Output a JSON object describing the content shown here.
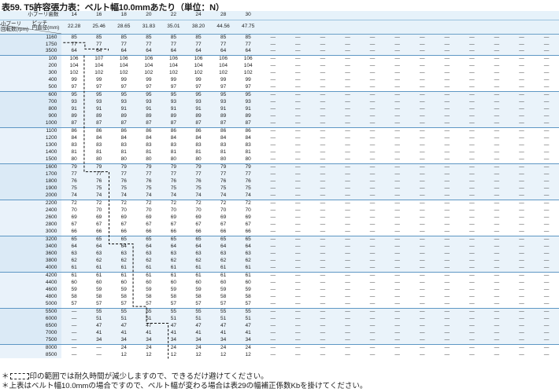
{
  "title": "表59. T5許容張力表：ベルト幅10.0mmあたり（単位：N）",
  "header": {
    "teeth_label": "小プーリ歯数",
    "pitch_label_line1": "ピッチ",
    "pitch_label_line2": "円直径(mm)",
    "rpm_label_line1": "小プーリ",
    "rpm_label_line2": "回転数(rpm)",
    "teeth": [
      "14",
      "16",
      "18",
      "20",
      "22",
      "24",
      "28",
      "30"
    ],
    "pitch_diameters": [
      "22.28",
      "25.46",
      "28.65",
      "31.83",
      "35.01",
      "38.20",
      "44.56",
      "47.75"
    ]
  },
  "dash_symbol": "—",
  "dash_columns": 12,
  "groups": [
    {
      "rows": [
        {
          "rpm": "1160",
          "values": [
            "85",
            "85",
            "85",
            "85",
            "85",
            "85",
            "85",
            "85"
          ]
        },
        {
          "rpm": "1750",
          "values": [
            "77",
            "77",
            "77",
            "77",
            "77",
            "77",
            "77",
            "77"
          ]
        },
        {
          "rpm": "3500",
          "values": [
            "64",
            "64",
            "64",
            "64",
            "64",
            "64",
            "64",
            "64"
          ]
        }
      ]
    },
    {
      "rows": [
        {
          "rpm": "100",
          "values": [
            "106",
            "107",
            "106",
            "106",
            "106",
            "106",
            "106",
            "106"
          ]
        },
        {
          "rpm": "200",
          "values": [
            "104",
            "104",
            "104",
            "104",
            "104",
            "104",
            "104",
            "104"
          ]
        },
        {
          "rpm": "300",
          "values": [
            "102",
            "102",
            "102",
            "102",
            "102",
            "102",
            "102",
            "102"
          ]
        },
        {
          "rpm": "400",
          "values": [
            "99",
            "99",
            "99",
            "99",
            "99",
            "99",
            "99",
            "99"
          ]
        },
        {
          "rpm": "500",
          "values": [
            "97",
            "97",
            "97",
            "97",
            "97",
            "97",
            "97",
            "97"
          ]
        }
      ]
    },
    {
      "rows": [
        {
          "rpm": "600",
          "values": [
            "95",
            "95",
            "95",
            "95",
            "95",
            "95",
            "95",
            "95"
          ]
        },
        {
          "rpm": "700",
          "values": [
            "93",
            "93",
            "93",
            "93",
            "93",
            "93",
            "93",
            "93"
          ]
        },
        {
          "rpm": "800",
          "values": [
            "91",
            "91",
            "91",
            "91",
            "91",
            "91",
            "91",
            "91"
          ]
        },
        {
          "rpm": "900",
          "values": [
            "89",
            "89",
            "89",
            "89",
            "89",
            "89",
            "89",
            "89"
          ]
        },
        {
          "rpm": "1000",
          "values": [
            "87",
            "87",
            "87",
            "87",
            "87",
            "87",
            "87",
            "87"
          ]
        }
      ]
    },
    {
      "rows": [
        {
          "rpm": "1100",
          "values": [
            "86",
            "86",
            "86",
            "86",
            "86",
            "86",
            "86",
            "86"
          ]
        },
        {
          "rpm": "1200",
          "values": [
            "84",
            "84",
            "84",
            "84",
            "84",
            "84",
            "84",
            "84"
          ]
        },
        {
          "rpm": "1300",
          "values": [
            "83",
            "83",
            "83",
            "83",
            "83",
            "83",
            "83",
            "83"
          ]
        },
        {
          "rpm": "1400",
          "values": [
            "81",
            "81",
            "81",
            "81",
            "81",
            "81",
            "81",
            "81"
          ]
        },
        {
          "rpm": "1500",
          "values": [
            "80",
            "80",
            "80",
            "80",
            "80",
            "80",
            "80",
            "80"
          ]
        }
      ]
    },
    {
      "rows": [
        {
          "rpm": "1600",
          "values": [
            "79",
            "79",
            "79",
            "79",
            "79",
            "79",
            "79",
            "79"
          ]
        },
        {
          "rpm": "1700",
          "values": [
            "77",
            "77",
            "77",
            "77",
            "77",
            "77",
            "77",
            "77"
          ]
        },
        {
          "rpm": "1800",
          "values": [
            "76",
            "76",
            "76",
            "76",
            "76",
            "76",
            "76",
            "76"
          ]
        },
        {
          "rpm": "1900",
          "values": [
            "75",
            "75",
            "75",
            "75",
            "75",
            "75",
            "75",
            "75"
          ]
        },
        {
          "rpm": "2000",
          "values": [
            "74",
            "74",
            "74",
            "74",
            "74",
            "74",
            "74",
            "74"
          ]
        }
      ]
    },
    {
      "rows": [
        {
          "rpm": "2200",
          "values": [
            "72",
            "72",
            "72",
            "72",
            "72",
            "72",
            "72",
            "72"
          ]
        },
        {
          "rpm": "2400",
          "values": [
            "70",
            "70",
            "70",
            "70",
            "70",
            "70",
            "70",
            "70"
          ]
        },
        {
          "rpm": "2600",
          "values": [
            "69",
            "69",
            "69",
            "69",
            "69",
            "69",
            "69",
            "69"
          ]
        },
        {
          "rpm": "2800",
          "values": [
            "67",
            "67",
            "67",
            "67",
            "67",
            "67",
            "67",
            "67"
          ]
        },
        {
          "rpm": "3000",
          "values": [
            "66",
            "66",
            "66",
            "66",
            "66",
            "66",
            "66",
            "66"
          ]
        }
      ]
    },
    {
      "rows": [
        {
          "rpm": "3200",
          "values": [
            "65",
            "65",
            "65",
            "65",
            "65",
            "65",
            "65",
            "65"
          ]
        },
        {
          "rpm": "3400",
          "values": [
            "64",
            "64",
            "64",
            "64",
            "64",
            "64",
            "64",
            "64"
          ]
        },
        {
          "rpm": "3600",
          "values": [
            "63",
            "63",
            "63",
            "63",
            "63",
            "63",
            "63",
            "63"
          ]
        },
        {
          "rpm": "3800",
          "values": [
            "62",
            "62",
            "62",
            "62",
            "62",
            "62",
            "62",
            "62"
          ]
        },
        {
          "rpm": "4000",
          "values": [
            "61",
            "61",
            "61",
            "61",
            "61",
            "61",
            "61",
            "61"
          ]
        }
      ]
    },
    {
      "rows": [
        {
          "rpm": "4200",
          "values": [
            "61",
            "61",
            "61",
            "61",
            "61",
            "61",
            "61",
            "61"
          ]
        },
        {
          "rpm": "4400",
          "values": [
            "60",
            "60",
            "60",
            "60",
            "60",
            "60",
            "60",
            "60"
          ]
        },
        {
          "rpm": "4600",
          "values": [
            "59",
            "59",
            "59",
            "59",
            "59",
            "59",
            "59",
            "59"
          ]
        },
        {
          "rpm": "4800",
          "values": [
            "58",
            "58",
            "58",
            "58",
            "58",
            "58",
            "58",
            "58"
          ]
        },
        {
          "rpm": "5000",
          "values": [
            "57",
            "57",
            "57",
            "57",
            "57",
            "57",
            "57",
            "57"
          ]
        }
      ]
    },
    {
      "rows": [
        {
          "rpm": "5500",
          "values": [
            "—",
            "55",
            "55",
            "55",
            "55",
            "55",
            "55",
            "55"
          ]
        },
        {
          "rpm": "6000",
          "values": [
            "—",
            "51",
            "51",
            "51",
            "51",
            "51",
            "51",
            "51"
          ]
        },
        {
          "rpm": "6500",
          "values": [
            "—",
            "47",
            "47",
            "47",
            "47",
            "47",
            "47",
            "47"
          ]
        },
        {
          "rpm": "7000",
          "values": [
            "—",
            "41",
            "41",
            "41",
            "41",
            "41",
            "41",
            "41"
          ]
        },
        {
          "rpm": "7500",
          "values": [
            "—",
            "34",
            "34",
            "34",
            "34",
            "34",
            "34",
            "34"
          ]
        }
      ]
    },
    {
      "rows": [
        {
          "rpm": "8000",
          "values": [
            "—",
            "—",
            "24",
            "24",
            "24",
            "24",
            "24",
            "24"
          ]
        },
        {
          "rpm": "8500",
          "values": [
            "—",
            "—",
            "12",
            "12",
            "12",
            "12",
            "12",
            "12"
          ]
        }
      ]
    }
  ],
  "notes": {
    "note1_prefix": "＊",
    "note1_text": "印の範囲では耐久時間が減少しますので、できるだけ避けてください。",
    "note2": "＊上表はベルト幅10.0mmの場合ですので、ベルト幅が変わる場合は表29の幅補正係数Kbを掛けてください。"
  }
}
